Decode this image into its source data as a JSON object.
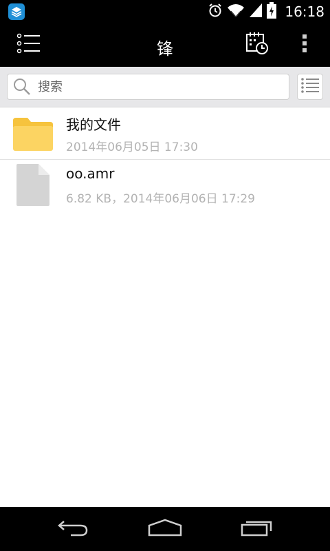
{
  "status_bar": {
    "time": "16:18",
    "icons": [
      "app-icon",
      "alarm-icon",
      "wifi-icon",
      "signal-icon",
      "battery-charging-icon"
    ]
  },
  "action_bar": {
    "title": "锋",
    "icons": [
      "drawer-menu-icon",
      "history-icon",
      "overflow-menu-icon"
    ]
  },
  "search": {
    "placeholder": "搜索"
  },
  "files": [
    {
      "name": "我的文件",
      "meta": "2014年06月05日 17:30",
      "icon": "folder-icon"
    },
    {
      "name": "oo.amr",
      "meta": "6.82 KB，2014年06月06日 17:29",
      "icon": "file-icon"
    }
  ],
  "nav_bar": {
    "icons": [
      "back-icon",
      "home-icon",
      "recents-icon"
    ]
  },
  "colors": {
    "bar": "#000000",
    "search_strip": "#e7e7e9",
    "folder": "#fcd462",
    "file": "#d4d4d4",
    "meta_text": "#b3b3b3",
    "app_icon": "#1f8fd6"
  }
}
